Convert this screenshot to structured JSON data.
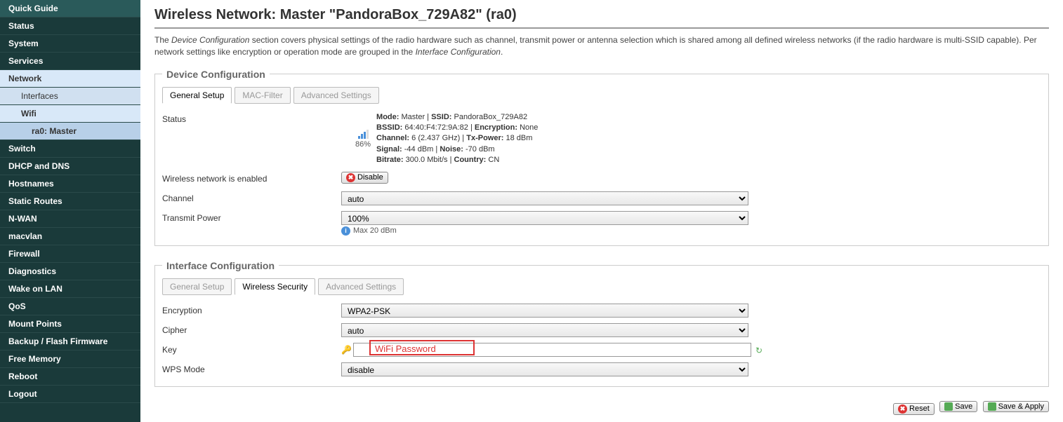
{
  "sidebar": {
    "items": [
      {
        "label": "Quick Guide"
      },
      {
        "label": "Status"
      },
      {
        "label": "System"
      },
      {
        "label": "Services"
      },
      {
        "label": "Network"
      },
      {
        "label": "Interfaces"
      },
      {
        "label": "Wifi"
      },
      {
        "label": "ra0: Master"
      },
      {
        "label": "Switch"
      },
      {
        "label": "DHCP and DNS"
      },
      {
        "label": "Hostnames"
      },
      {
        "label": "Static Routes"
      },
      {
        "label": "N-WAN"
      },
      {
        "label": "macvlan"
      },
      {
        "label": "Firewall"
      },
      {
        "label": "Diagnostics"
      },
      {
        "label": "Wake on LAN"
      },
      {
        "label": "QoS"
      },
      {
        "label": "Mount Points"
      },
      {
        "label": "Backup / Flash Firmware"
      },
      {
        "label": "Free Memory"
      },
      {
        "label": "Reboot"
      },
      {
        "label": "Logout"
      }
    ]
  },
  "page": {
    "title": "Wireless Network: Master \"PandoraBox_729A82\" (ra0)",
    "desc_pre": "The ",
    "desc_em1": "Device Configuration",
    "desc_mid": " section covers physical settings of the radio hardware such as channel, transmit power or antenna selection which is shared among all defined wireless networks (if the radio hardware is multi-SSID capable). Per network settings like encryption or operation mode are grouped in the ",
    "desc_em2": "Interface Configuration",
    "desc_post": "."
  },
  "device": {
    "legend": "Device Configuration",
    "tabs": {
      "general": "General Setup",
      "mac": "MAC-Filter",
      "adv": "Advanced Settings"
    },
    "status_label": "Status",
    "signal_pct": "86%",
    "status": {
      "mode_l": "Mode:",
      "mode_v": "Master",
      "ssid_l": "SSID:",
      "ssid_v": "PandoraBox_729A82",
      "bssid_l": "BSSID:",
      "bssid_v": "64:40:F4:72:9A:82",
      "enc_l": "Encryption:",
      "enc_v": "None",
      "ch_l": "Channel:",
      "ch_v": "6 (2.437 GHz)",
      "tx_l": "Tx-Power:",
      "tx_v": "18 dBm",
      "sig_l": "Signal:",
      "sig_v": "-44 dBm",
      "noise_l": "Noise:",
      "noise_v": "-70 dBm",
      "br_l": "Bitrate:",
      "br_v": "300.0 Mbit/s",
      "co_l": "Country:",
      "co_v": "CN"
    },
    "enabled_label": "Wireless network is enabled",
    "disable_btn": "Disable",
    "channel_label": "Channel",
    "channel_value": "auto",
    "txpower_label": "Transmit Power",
    "txpower_value": "100%",
    "txpower_hint": "Max 20 dBm"
  },
  "iface": {
    "legend": "Interface Configuration",
    "tabs": {
      "general": "General Setup",
      "sec": "Wireless Security",
      "adv": "Advanced Settings"
    },
    "encryption_label": "Encryption",
    "encryption_value": "WPA2-PSK",
    "cipher_label": "Cipher",
    "cipher_value": "auto",
    "key_label": "Key",
    "key_value": "",
    "key_callout": "WiFi Password",
    "wps_label": "WPS Mode",
    "wps_value": "disable"
  },
  "buttons": {
    "reset": "Reset",
    "save": "Save",
    "saveapply": "Save & Apply"
  }
}
